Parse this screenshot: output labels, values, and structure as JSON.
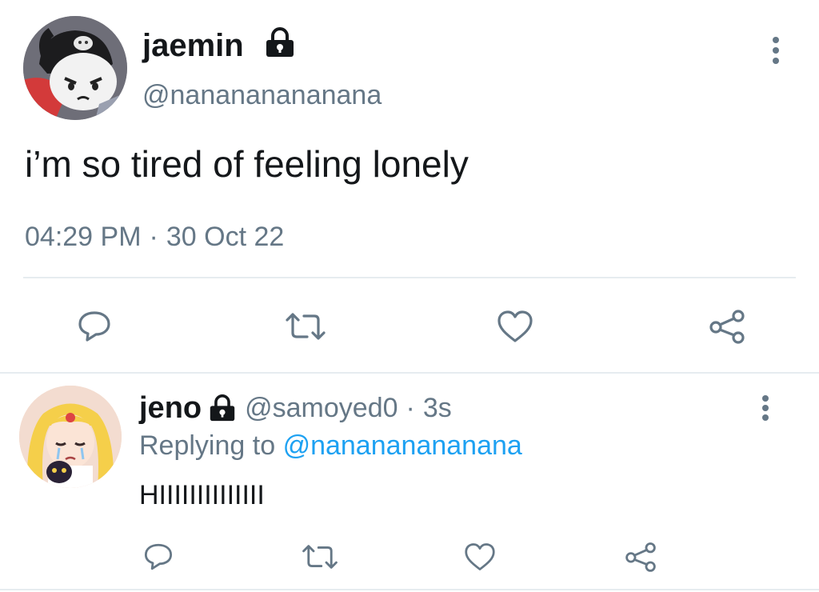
{
  "tweet": {
    "display_name": "jaemin",
    "handle": "@nanananananana",
    "text": "i’m so tired of feeling lonely",
    "time": "04:29 PM",
    "separator": "·",
    "date": "30 Oct 22"
  },
  "reply": {
    "display_name": "jeno",
    "handle": "@samoyed0",
    "separator": "·",
    "age": "3s",
    "replying_prefix": "Replying to",
    "replying_to": "@nanananananana",
    "text": "HIIIIIIIIIIIIII"
  },
  "icons": {
    "protected": "lock-icon",
    "more": "more-vertical-icon",
    "reply": "reply-icon",
    "retweet": "retweet-icon",
    "like": "heart-icon",
    "share": "share-icon"
  },
  "colors": {
    "text": "#14171a",
    "secondary": "#657786",
    "link": "#1da1f2",
    "divider": "#e6ecf0"
  }
}
